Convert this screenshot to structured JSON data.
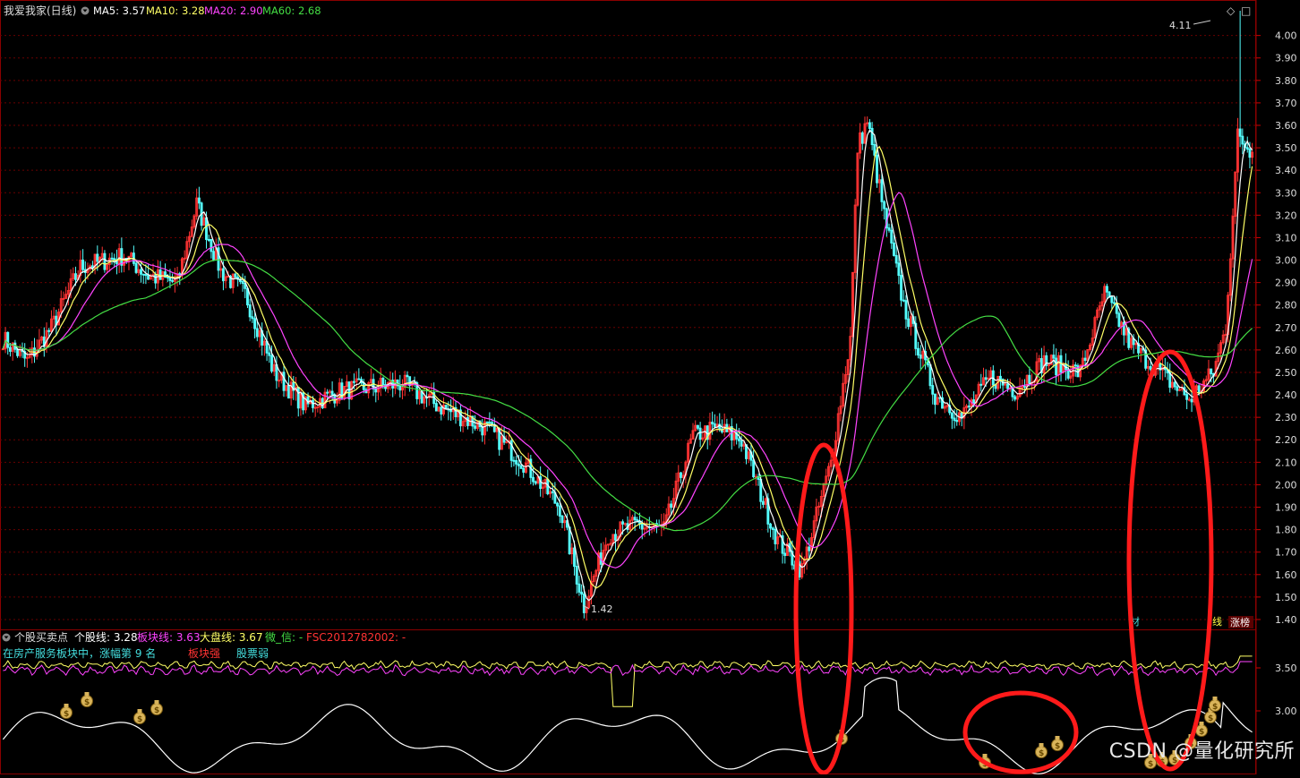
{
  "main_panel": {
    "stock_name": "我爱我家(日线)",
    "ma_items": [
      {
        "label": "MA5: 3.57",
        "color": "#ffffff"
      },
      {
        "label": "MA10: 3.28",
        "color": "#ffff66"
      },
      {
        "label": "MA20: 2.90",
        "color": "#ff44ff"
      },
      {
        "label": "MA60: 2.68",
        "color": "#44dd44"
      }
    ],
    "price_axis": [
      "4.00",
      "3.90",
      "3.80",
      "3.70",
      "3.60",
      "3.50",
      "3.40",
      "3.30",
      "3.20",
      "3.10",
      "3.00",
      "2.90",
      "2.80",
      "2.70",
      "2.60",
      "2.50",
      "2.40",
      "2.30",
      "2.20",
      "2.10",
      "2.00",
      "1.90",
      "1.80",
      "1.70",
      "1.60",
      "1.50",
      "1.40"
    ],
    "high_label": "4.11",
    "low_label": "1.42",
    "corner_badges": [
      "材",
      "线",
      "涨榜"
    ],
    "controls": [
      "◇",
      "□"
    ]
  },
  "sub_panel": {
    "title": "个股买卖点",
    "items": [
      {
        "label": "个股线: 3.28",
        "color": "#ffffff"
      },
      {
        "label": "板块线: 3.63",
        "color": "#ff44ff"
      },
      {
        "label": "大盘线: 3.67",
        "color": "#ffff66"
      },
      {
        "label": "微_信: -",
        "color": "#44dd44"
      },
      {
        "label": "FSC2012782002: -",
        "color": "#ff3333"
      }
    ],
    "status_line": {
      "text": "在房产服务板块中，涨幅第 9 名",
      "color": "#44dddd"
    },
    "status_items": [
      {
        "label": "板块强",
        "color": "#ff3333"
      },
      {
        "label": "股票弱",
        "color": "#44dddd"
      }
    ],
    "axis": [
      "3.50",
      "3.00"
    ]
  },
  "colors": {
    "up": "#ff3333",
    "down": "#54ffff",
    "grid": "#6a0000",
    "ma5": "#ffffff",
    "ma10": "#ffff66",
    "ma20": "#ff44ff",
    "ma60": "#44dd44",
    "highlight": "#ff1a1a"
  },
  "watermark": "CSDN @量化研究所",
  "chart_data": {
    "type": "candlestick",
    "title": "我爱我家(日线)",
    "y_range": [
      1.36,
      4.15
    ],
    "x_count": 260,
    "anchors": [
      [
        0,
        2.65
      ],
      [
        10,
        2.55
      ],
      [
        20,
        2.7
      ],
      [
        32,
        2.97
      ],
      [
        50,
        3.02
      ],
      [
        60,
        2.93
      ],
      [
        72,
        2.9
      ],
      [
        80,
        3.25
      ],
      [
        90,
        2.95
      ],
      [
        100,
        2.85
      ],
      [
        112,
        2.5
      ],
      [
        125,
        2.35
      ],
      [
        140,
        2.42
      ],
      [
        165,
        2.45
      ],
      [
        180,
        2.35
      ],
      [
        200,
        2.25
      ],
      [
        215,
        2.1
      ],
      [
        230,
        1.9
      ],
      [
        240,
        1.46
      ],
      [
        250,
        1.78
      ],
      [
        262,
        1.82
      ],
      [
        273,
        1.8
      ],
      [
        285,
        2.22
      ],
      [
        295,
        2.25
      ],
      [
        305,
        2.2
      ],
      [
        320,
        1.75
      ],
      [
        330,
        1.62
      ],
      [
        342,
        2.1
      ],
      [
        350,
        2.65
      ],
      [
        353,
        3.5
      ],
      [
        357,
        3.62
      ],
      [
        364,
        3.2
      ],
      [
        372,
        2.8
      ],
      [
        385,
        2.4
      ],
      [
        396,
        2.3
      ],
      [
        408,
        2.48
      ],
      [
        418,
        2.42
      ],
      [
        430,
        2.55
      ],
      [
        445,
        2.5
      ],
      [
        455,
        2.85
      ],
      [
        466,
        2.62
      ],
      [
        478,
        2.5
      ],
      [
        490,
        2.38
      ],
      [
        500,
        2.5
      ],
      [
        505,
        2.7
      ],
      [
        510,
        3.55
      ],
      [
        516,
        3.48
      ]
    ],
    "ma_visible_values": {
      "MA5": 3.57,
      "MA10": 3.28,
      "MA20": 2.9,
      "MA60": 2.68
    },
    "extremes": {
      "high": 4.11,
      "low": 1.42
    },
    "sub_values": {
      "个股线": 3.28,
      "板块线": 3.63,
      "大盘线": 3.67
    },
    "sub_y_range": [
      2.6,
      3.9
    ]
  }
}
